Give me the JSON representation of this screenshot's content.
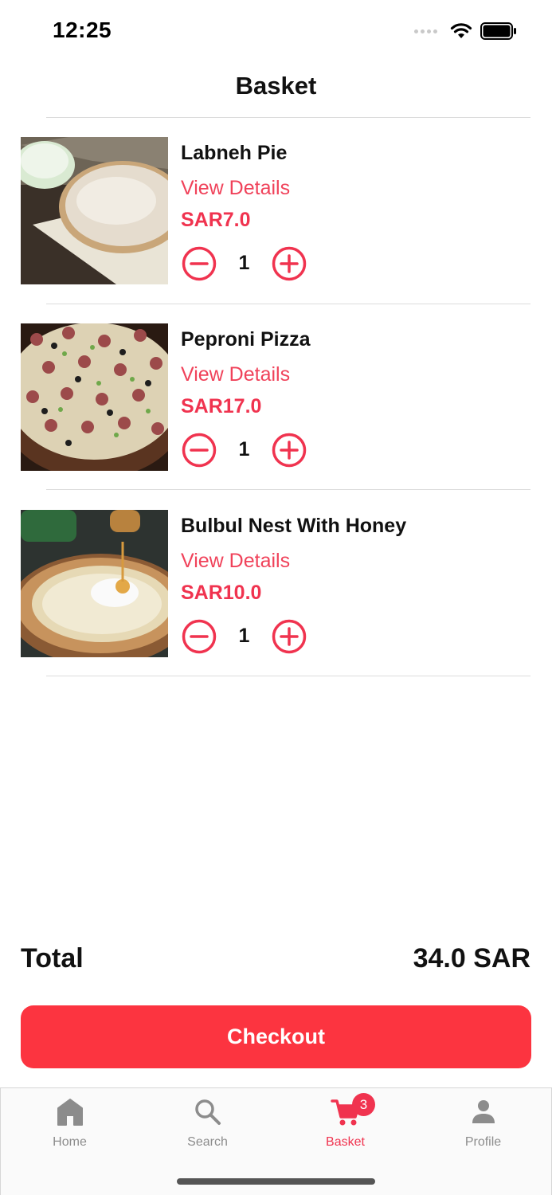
{
  "status_bar": {
    "time": "12:25"
  },
  "header": {
    "title": "Basket"
  },
  "items": [
    {
      "name": "Labneh Pie",
      "details_label": "View Details",
      "price": "SAR7.0",
      "quantity": "1"
    },
    {
      "name": "Peproni Pizza",
      "details_label": "View Details",
      "price": "SAR17.0",
      "quantity": "1"
    },
    {
      "name": "Bulbul Nest With Honey",
      "details_label": "View Details",
      "price": "SAR10.0",
      "quantity": "1"
    }
  ],
  "summary": {
    "total_label": "Total",
    "total_value": "34.0 SAR"
  },
  "checkout": {
    "label": "Checkout"
  },
  "tab_bar": {
    "tabs": [
      {
        "label": "Home",
        "icon": "home-icon",
        "active": false
      },
      {
        "label": "Search",
        "icon": "search-icon",
        "active": false
      },
      {
        "label": "Basket",
        "icon": "cart-icon",
        "active": true,
        "badge": "3"
      },
      {
        "label": "Profile",
        "icon": "person-icon",
        "active": false
      }
    ]
  },
  "colors": {
    "accent": "#f0334f",
    "checkout_button": "#fc3440",
    "link": "#f0425a",
    "inactive_tab": "#8c8c8c"
  }
}
